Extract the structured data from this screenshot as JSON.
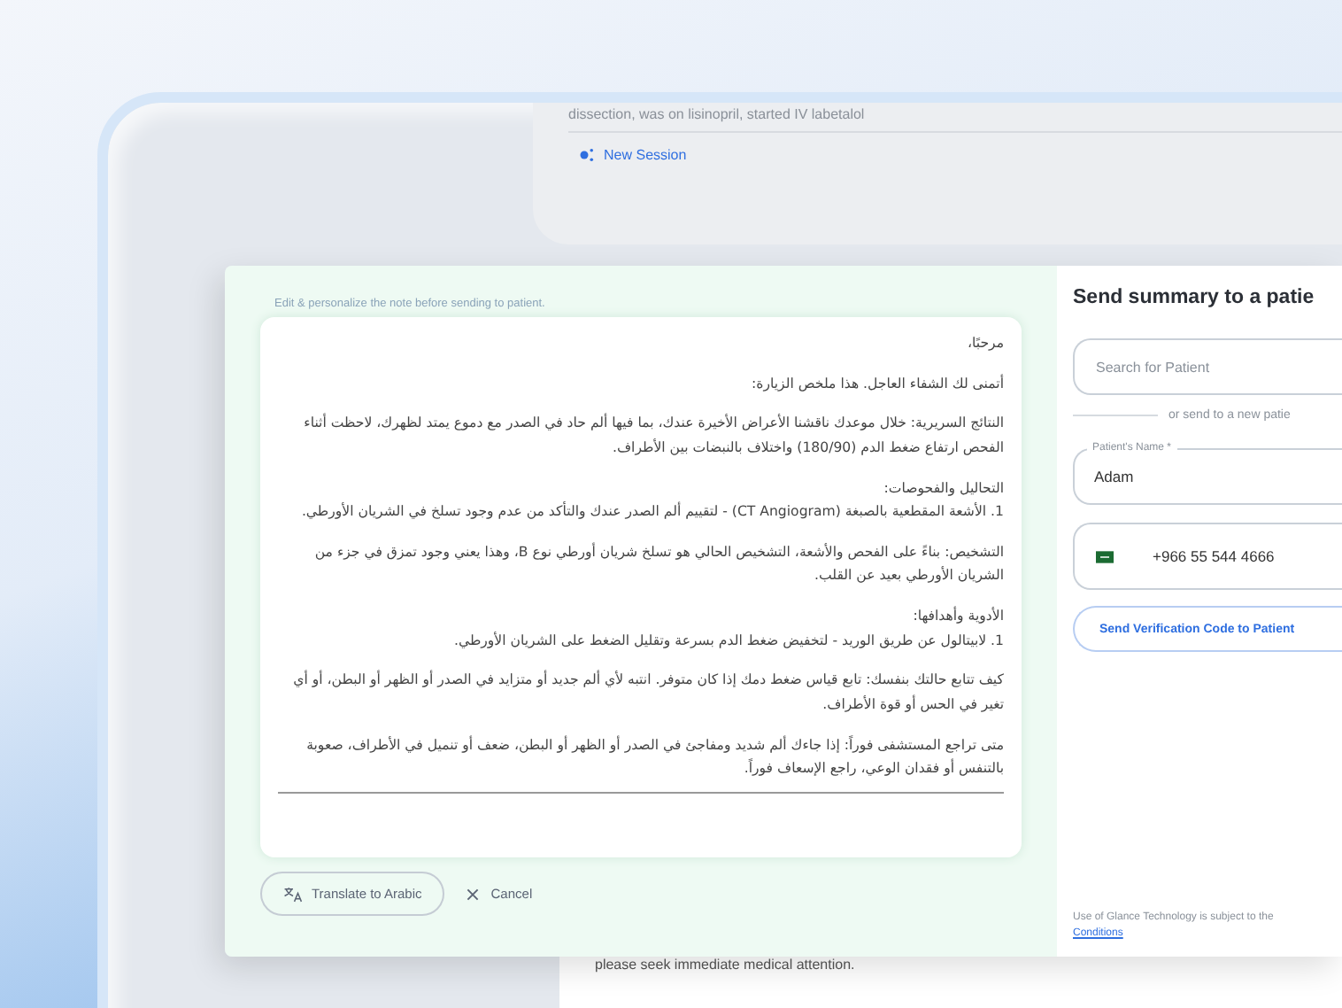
{
  "background": {
    "session_note": "dissection, was on lisinopril, started IV labetalol",
    "new_session_button": "New Session",
    "note_tail": "please seek immediate medical attention."
  },
  "editor": {
    "hint": "Edit & personalize the note before sending to patient.",
    "paragraphs": [
      {
        "lines": [
          "مرحبًا،"
        ]
      },
      {
        "lines": [
          "أتمنى لك الشفاء العاجل. هذا ملخص الزيارة:"
        ]
      },
      {
        "lines": [
          "النتائج السريرية: خلال موعدك ناقشنا الأعراض الأخيرة عندك، بما فيها ألم حاد في الصدر مع دموع يمتد لظهرك، لاحظت أثناء الفحص ارتفاع ضغط الدم (180/90) واختلاف بالنبضات بين الأطراف."
        ]
      },
      {
        "lines": [
          "التحاليل والفحوصات:",
          "1. الأشعة المقطعية بالصبغة (CT Angiogram) - لتقييم ألم الصدر عندك والتأكد من عدم وجود تسلخ في الشريان الأورطي."
        ]
      },
      {
        "lines": [
          "التشخيص: بناءً على الفحص والأشعة، التشخيص الحالي هو تسلخ شريان أورطي نوع B، وهذا يعني وجود تمزق في جزء من الشريان الأورطي بعيد عن القلب."
        ]
      },
      {
        "lines": [
          "الأدوية وأهدافها:",
          "1. لابيتالول عن طريق الوريد - لتخفيض ضغط الدم بسرعة وتقليل الضغط على الشريان الأورطي."
        ]
      },
      {
        "lines": [
          "كيف تتابع حالتك بنفسك: تابع قياس ضغط دمك إذا كان متوفر. انتبه لأي ألم جديد أو متزايد في الصدر أو الظهر أو البطن، أو أي تغير في الحس أو قوة الأطراف."
        ]
      },
      {
        "lines": [
          "متى تراجع المستشفى فوراً: إذا جاءك ألم شديد ومفاجئ في الصدر أو الظهر أو البطن، ضعف أو تنميل في الأطراف، صعوبة بالتنفس أو فقدان الوعي، راجع الإسعاف فوراً."
        ]
      }
    ]
  },
  "translate_button": "Translate to Arabic",
  "cancel_button": "Cancel",
  "send_panel": {
    "title": "Send summary to a patie",
    "search": {
      "placeholder": "Search for Patient"
    },
    "divider_text": "or send to a new patie",
    "name_field": {
      "label": "Patient's Name *",
      "value": "Adam"
    },
    "phone_field": {
      "value": "+966 55 544 4666"
    },
    "verify_button": "Send Verification Code to Patient",
    "terms": "Use of Glance Technology is subject to the",
    "terms_link": "Conditions"
  }
}
